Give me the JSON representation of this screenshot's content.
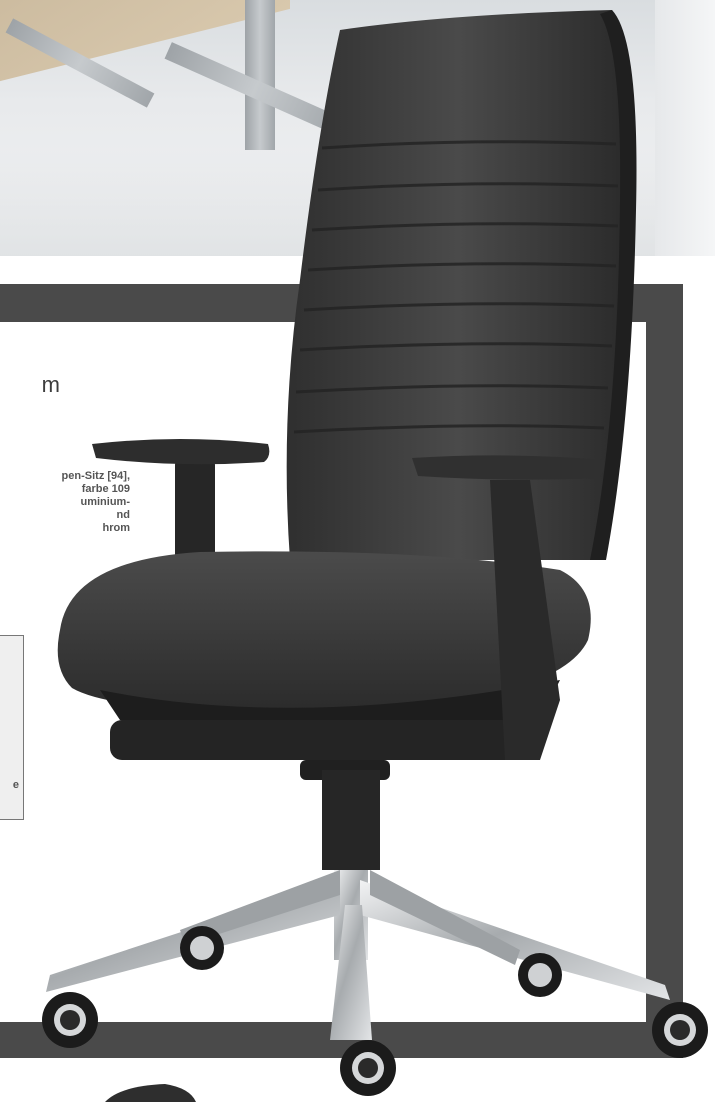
{
  "text_fragments": {
    "headline": "m",
    "description_lines": [
      "pen-Sitz [94],",
      "farbe 109",
      "uminium-",
      "nd",
      "hrom"
    ],
    "info_box_fragment": "e"
  },
  "colors": {
    "frame": "#4a4a4a",
    "chair_fabric": "#3a3a3a",
    "base_metal": "#c9ccce",
    "info_box_bg": "#efefef"
  }
}
